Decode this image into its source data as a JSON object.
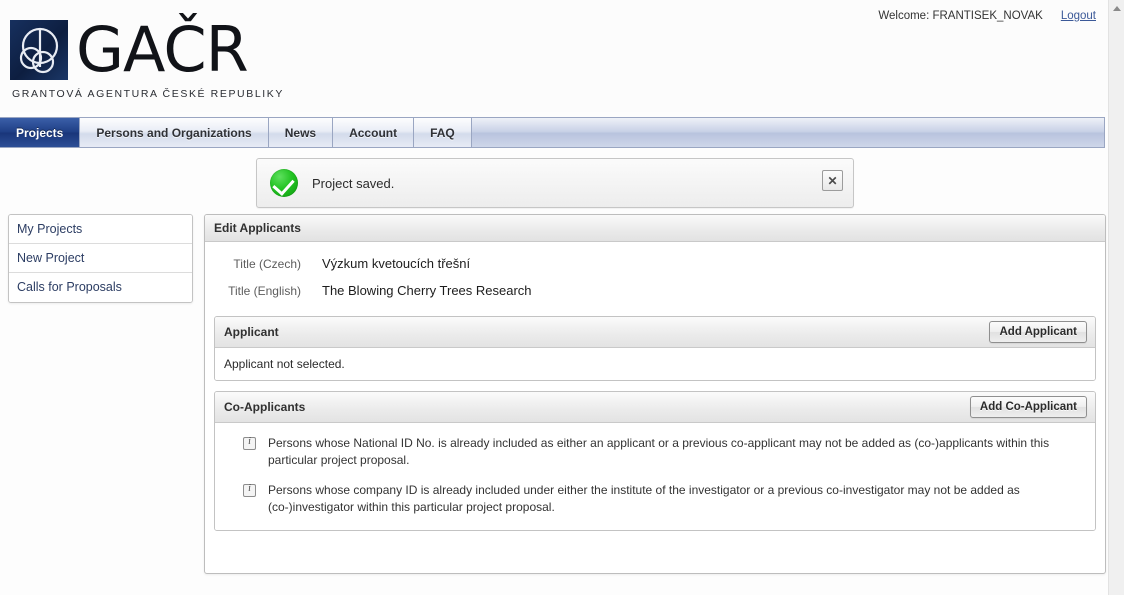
{
  "header": {
    "welcome_label": "Welcome: FRANTISEK_NOVAK",
    "logout_label": "Logout",
    "logo_text": "GAČR",
    "logo_subtitle": "GRANTOVÁ AGENTURA ČESKÉ REPUBLIKY"
  },
  "nav": {
    "tabs": [
      {
        "label": "Projects",
        "active": true
      },
      {
        "label": "Persons and Organizations",
        "active": false
      },
      {
        "label": "News",
        "active": false
      },
      {
        "label": "Account",
        "active": false
      },
      {
        "label": "FAQ",
        "active": false
      }
    ]
  },
  "flash": {
    "icon": "success-check-icon",
    "message": "Project saved.",
    "close_label": "✕"
  },
  "sidebar": {
    "items": [
      {
        "label": "My Projects"
      },
      {
        "label": "New Project"
      },
      {
        "label": "Calls for Proposals"
      }
    ]
  },
  "main": {
    "panel_title": "Edit Applicants",
    "fields": [
      {
        "label": "Title (Czech)",
        "value": "Výzkum kvetoucích třešní"
      },
      {
        "label": "Title (English)",
        "value": "The Blowing Cherry Trees Research"
      }
    ],
    "applicant": {
      "title": "Applicant",
      "add_button": "Add Applicant",
      "empty_text": "Applicant not selected."
    },
    "coapplicants": {
      "title": "Co-Applicants",
      "add_button": "Add Co-Applicant",
      "notes": [
        "Persons whose National ID No. is already included as either an applicant or a previous co-applicant may not be added as (co-)applicants within this particular project proposal.",
        "Persons whose company ID is already included under either the institute of the investigator or a previous co-investigator may not be added as (co-)investigator within this particular project proposal."
      ]
    }
  },
  "colors": {
    "accent_blue": "#1f3f86",
    "link_blue": "#3b5998",
    "success_green": "#22c322",
    "logo_navy": "#17305e"
  }
}
